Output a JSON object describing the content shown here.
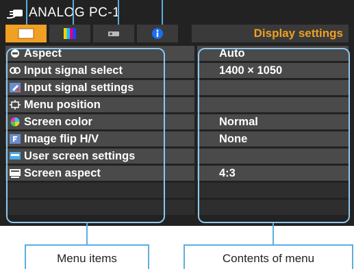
{
  "header": {
    "source_name": "ANALOG PC-1",
    "menu_title": "Display settings"
  },
  "tabs": [
    {
      "name": "display",
      "icon": "display-settings-icon",
      "active": true
    },
    {
      "name": "color",
      "icon": "color-bars-icon",
      "active": false
    },
    {
      "name": "setup",
      "icon": "projector-icon",
      "active": false
    },
    {
      "name": "info",
      "icon": "info-icon",
      "active": false
    }
  ],
  "menu": {
    "items": [
      {
        "label": "Aspect",
        "value": "Auto",
        "icon": "aspect-icon"
      },
      {
        "label": "Input signal select",
        "value": "1400 × 1050",
        "icon": "input-select-icon"
      },
      {
        "label": "Input signal settings",
        "value": "",
        "icon": "input-settings-icon"
      },
      {
        "label": "Menu position",
        "value": "",
        "icon": "menu-position-icon"
      },
      {
        "label": "Screen color",
        "value": "Normal",
        "icon": "screen-color-icon"
      },
      {
        "label": "Image flip H/V",
        "value": "None",
        "icon": "image-flip-icon"
      },
      {
        "label": "User screen settings",
        "value": "",
        "icon": "user-screen-icon"
      },
      {
        "label": "Screen aspect",
        "value": "4:3",
        "icon": "screen-aspect-icon"
      }
    ]
  },
  "callouts": {
    "menu_items": "Menu items",
    "contents_of_menu": "Contents of menu"
  },
  "colors": {
    "accent": "#f0a022",
    "frame": "#8ec8f0",
    "row_bg": "#4a4a4a",
    "screen_bg": "#222222"
  }
}
